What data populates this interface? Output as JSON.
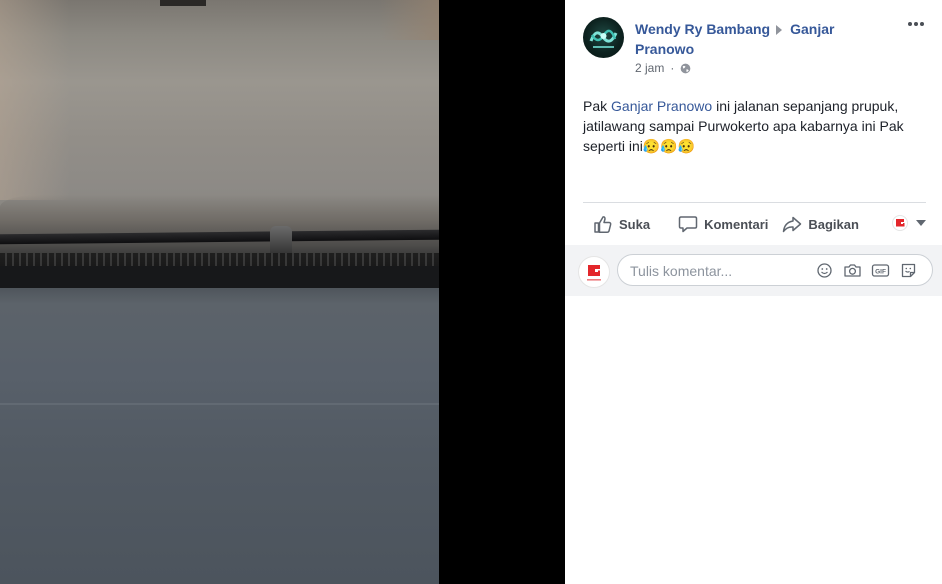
{
  "post": {
    "author": "Wendy Ry Bambang",
    "target": "Ganjar Pranowo",
    "time": "2 jam",
    "text_before": "Pak ",
    "mention": "Ganjar Pranowo",
    "text_after": " ini jalanan sepanjang prupuk, jatilawang sampai Purwokerto apa kabarnya ini Pak seperti ini",
    "emoji": "😥😥😥"
  },
  "actions": {
    "like_label": "Suka",
    "comment_label": "Komentari",
    "share_label": "Bagikan"
  },
  "comment_box": {
    "placeholder": "Tulis komentar..."
  },
  "icons": {
    "like": "thumbs-up-icon",
    "comment": "speech-bubble-icon",
    "share": "share-arrow-icon",
    "privacy": "globe-icon",
    "menu": "more-options-icon",
    "emoji": "emoji-icon",
    "camera": "camera-icon",
    "gif": "gif-icon",
    "sticker": "sticker-icon"
  },
  "colors": {
    "link": "#365899",
    "text": "#1d2129",
    "muted": "#616770",
    "page_logo_red": "#e3262b"
  }
}
